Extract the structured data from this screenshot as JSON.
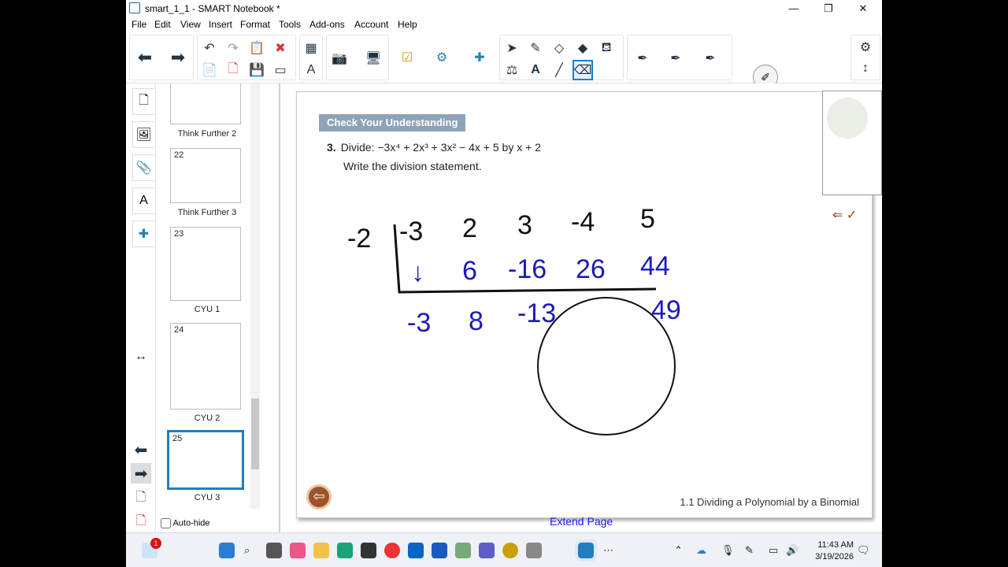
{
  "window": {
    "title": "smart_1_1 - SMART Notebook *"
  },
  "menu": [
    "File",
    "Edit",
    "View",
    "Insert",
    "Format",
    "Tools",
    "Add-ons",
    "Account",
    "Help"
  ],
  "sorter": {
    "thumbs": [
      {
        "num": "",
        "label": "Think Further 2"
      },
      {
        "num": "22",
        "label": "Think Further 3"
      },
      {
        "num": "23",
        "label": "CYU 1"
      },
      {
        "num": "24",
        "label": "CYU 2"
      },
      {
        "num": "25",
        "label": "CYU 3"
      }
    ],
    "auto_hide": "Auto-hide"
  },
  "page": {
    "banner": "Check Your Understanding",
    "problem_num": "3.",
    "problem_text": "Divide: −3x⁴ + 2x³ + 3x² − 4x + 5 by x + 2",
    "write_text": "Write the division statement.",
    "footer": "1.1 Dividing a Polynomial by a Binomial",
    "handwriting": {
      "divisor": "-2",
      "coeffs": [
        "-3",
        "2",
        "3",
        "-4",
        "5"
      ],
      "products": [
        "↓",
        "6",
        "-16",
        "26",
        "44"
      ],
      "results": [
        "-3",
        "8",
        "-13",
        "49"
      ]
    }
  },
  "extend_page": "Extend Page",
  "taskbar": {
    "time": "11:43 AM",
    "date": "3/19/2026",
    "badge": "1"
  }
}
